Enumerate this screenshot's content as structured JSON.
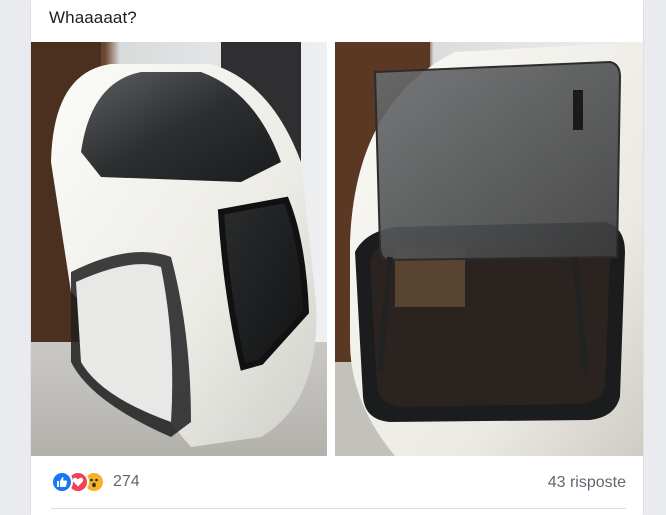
{
  "post": {
    "caption": "Whaaaaat?",
    "photos": [
      {
        "subject": "white car rear hatch with tinted window, side view"
      },
      {
        "subject": "white car rear hatch with tinted sunroof-style window panel"
      }
    ]
  },
  "footer": {
    "reactions": [
      "like-icon",
      "love-icon",
      "wow-icon"
    ],
    "reaction_count": "274",
    "comments_label": "43 risposte"
  },
  "colors": {
    "like": "#1877f2",
    "love": "#f33e58",
    "wow": "#f7b125",
    "meta_text": "#606770"
  }
}
